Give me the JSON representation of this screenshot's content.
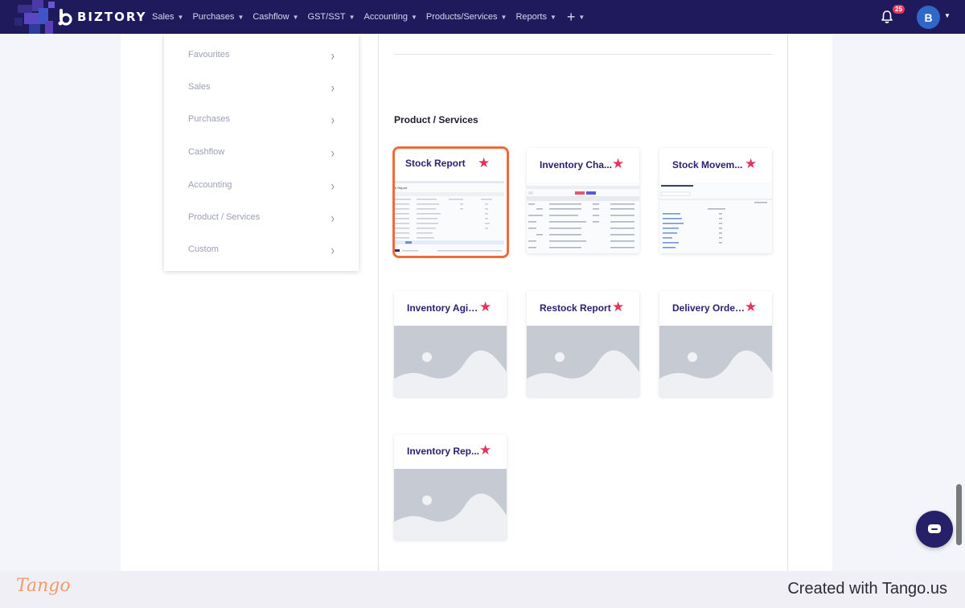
{
  "brand": {
    "name": "BIZTORY"
  },
  "nav": {
    "items": [
      {
        "label": "Sales"
      },
      {
        "label": "Purchases"
      },
      {
        "label": "Cashflow"
      },
      {
        "label": "GST/SST"
      },
      {
        "label": "Accounting"
      },
      {
        "label": "Products/Services"
      },
      {
        "label": "Reports"
      }
    ],
    "plus_label": "+",
    "notification_count": "25",
    "avatar_initial": "B"
  },
  "sidebar": {
    "items": [
      {
        "label": "Favourites"
      },
      {
        "label": "Sales"
      },
      {
        "label": "Purchases"
      },
      {
        "label": "Cashflow"
      },
      {
        "label": "Accounting"
      },
      {
        "label": "Product / Services"
      },
      {
        "label": "Custom"
      }
    ]
  },
  "main": {
    "section_title": "Product / Services",
    "reports": [
      {
        "title": "Stock Report",
        "favourite": true,
        "thumbnail": "screenshot",
        "highlighted": true
      },
      {
        "title": "Inventory Cha...",
        "favourite": true,
        "thumbnail": "screenshot"
      },
      {
        "title": "Stock Movem...",
        "favourite": true,
        "thumbnail": "screenshot"
      },
      {
        "title": "Inventory Agin...",
        "favourite": true,
        "thumbnail": "placeholder"
      },
      {
        "title": "Restock Report",
        "favourite": true,
        "thumbnail": "placeholder"
      },
      {
        "title": "Delivery Order...",
        "favourite": true,
        "thumbnail": "placeholder"
      },
      {
        "title": "Inventory Rep...",
        "favourite": true,
        "thumbnail": "placeholder"
      }
    ]
  },
  "footer": {
    "logo_text": "Tango",
    "credit": "Created with Tango.us"
  },
  "colors": {
    "navbar": "#1f1a5c",
    "highlight_border": "#f06a3b",
    "star": "#e4355f",
    "card_title": "#2a1f6e"
  }
}
